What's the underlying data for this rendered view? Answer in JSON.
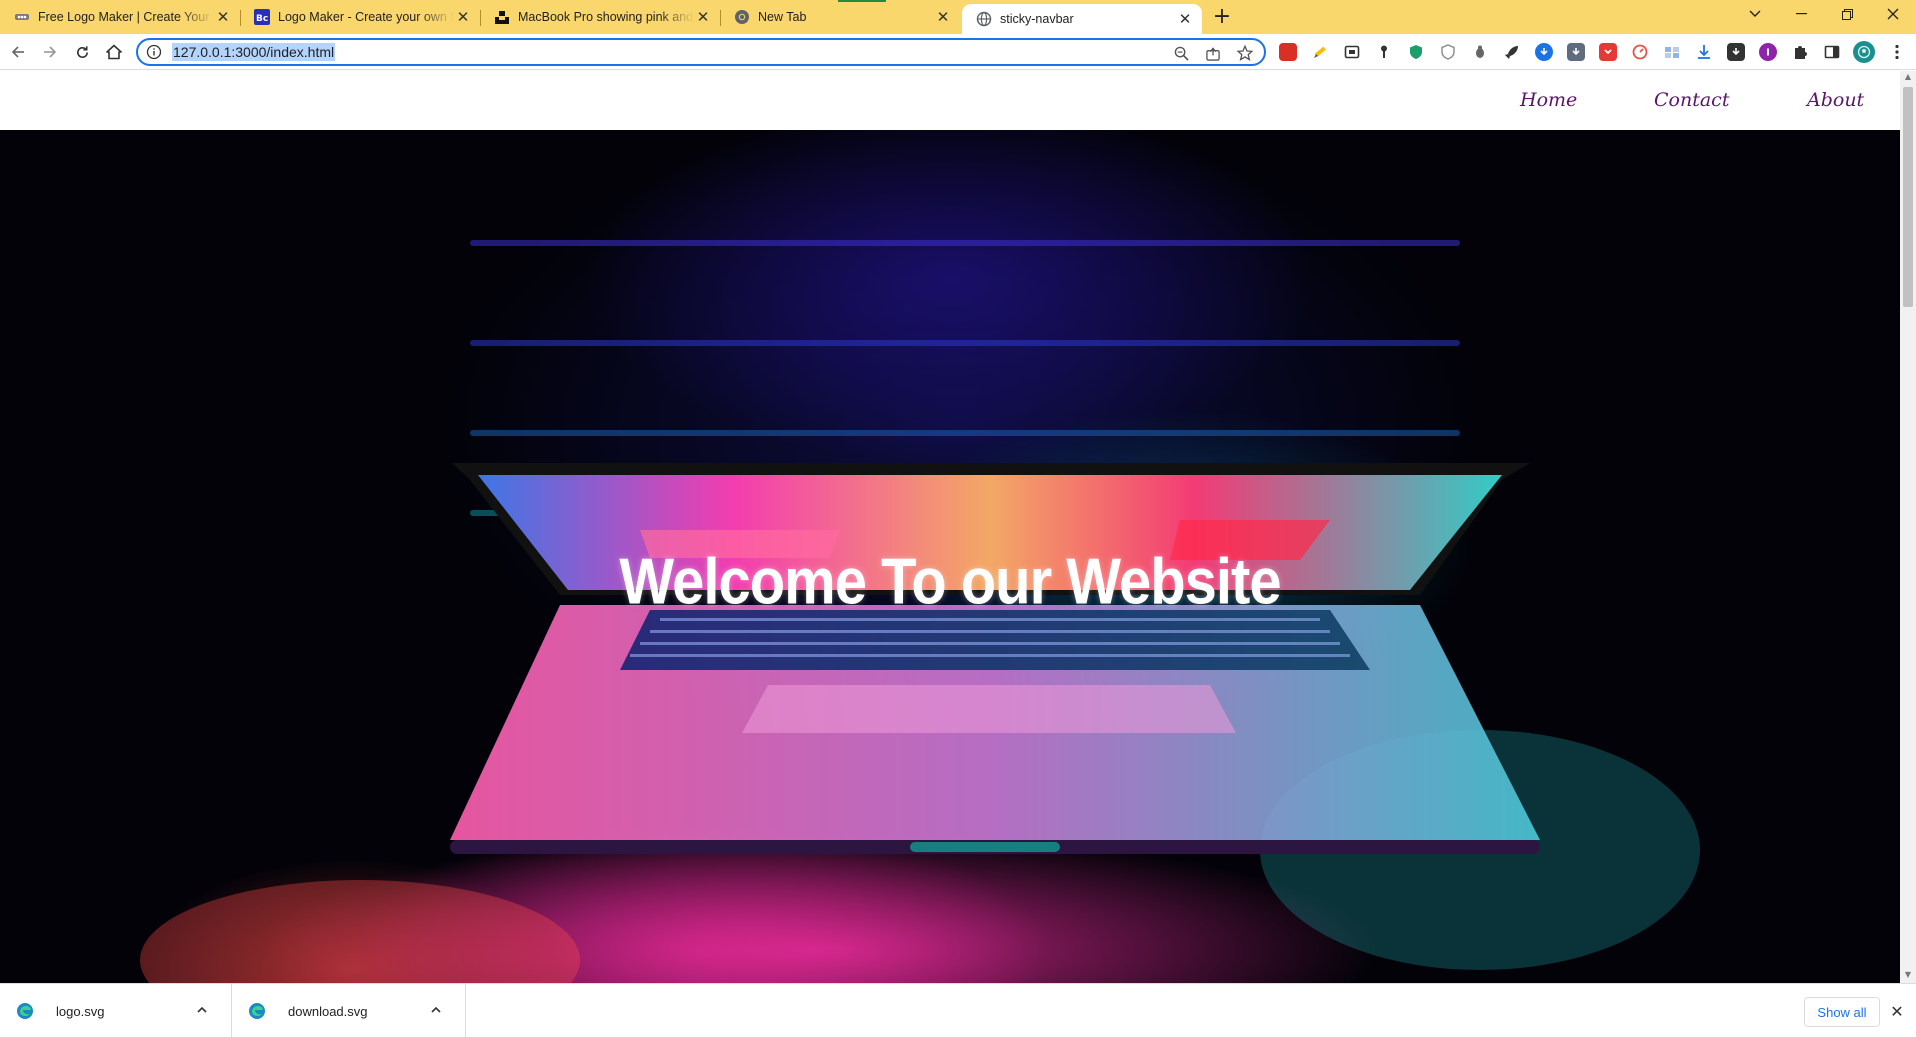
{
  "browser": {
    "tabs": [
      {
        "title": "Free Logo Maker | Create Your Lo",
        "icon": "logo-maker-favicon"
      },
      {
        "title": "Logo Maker - Create your own S",
        "icon": "bc-favicon"
      },
      {
        "title": "MacBook Pro showing pink and c",
        "icon": "unsplash-favicon"
      },
      {
        "title": "New Tab",
        "icon": "chrome-favicon"
      },
      {
        "title": "sticky-navbar",
        "icon": "globe-favicon",
        "active": true
      }
    ],
    "address": "127.0.0.1:3000/index.html",
    "accent_color": "#f9d76d",
    "focus_color": "#1a73e8"
  },
  "page": {
    "nav_links": [
      {
        "label": "Home"
      },
      {
        "label": "Contact"
      },
      {
        "label": "About"
      }
    ],
    "nav_link_color": "#5a176a",
    "hero_title": "Welcome To our Website"
  },
  "downloads": {
    "items": [
      {
        "name": "logo.svg"
      },
      {
        "name": "download.svg"
      }
    ],
    "show_all_label": "Show all"
  }
}
